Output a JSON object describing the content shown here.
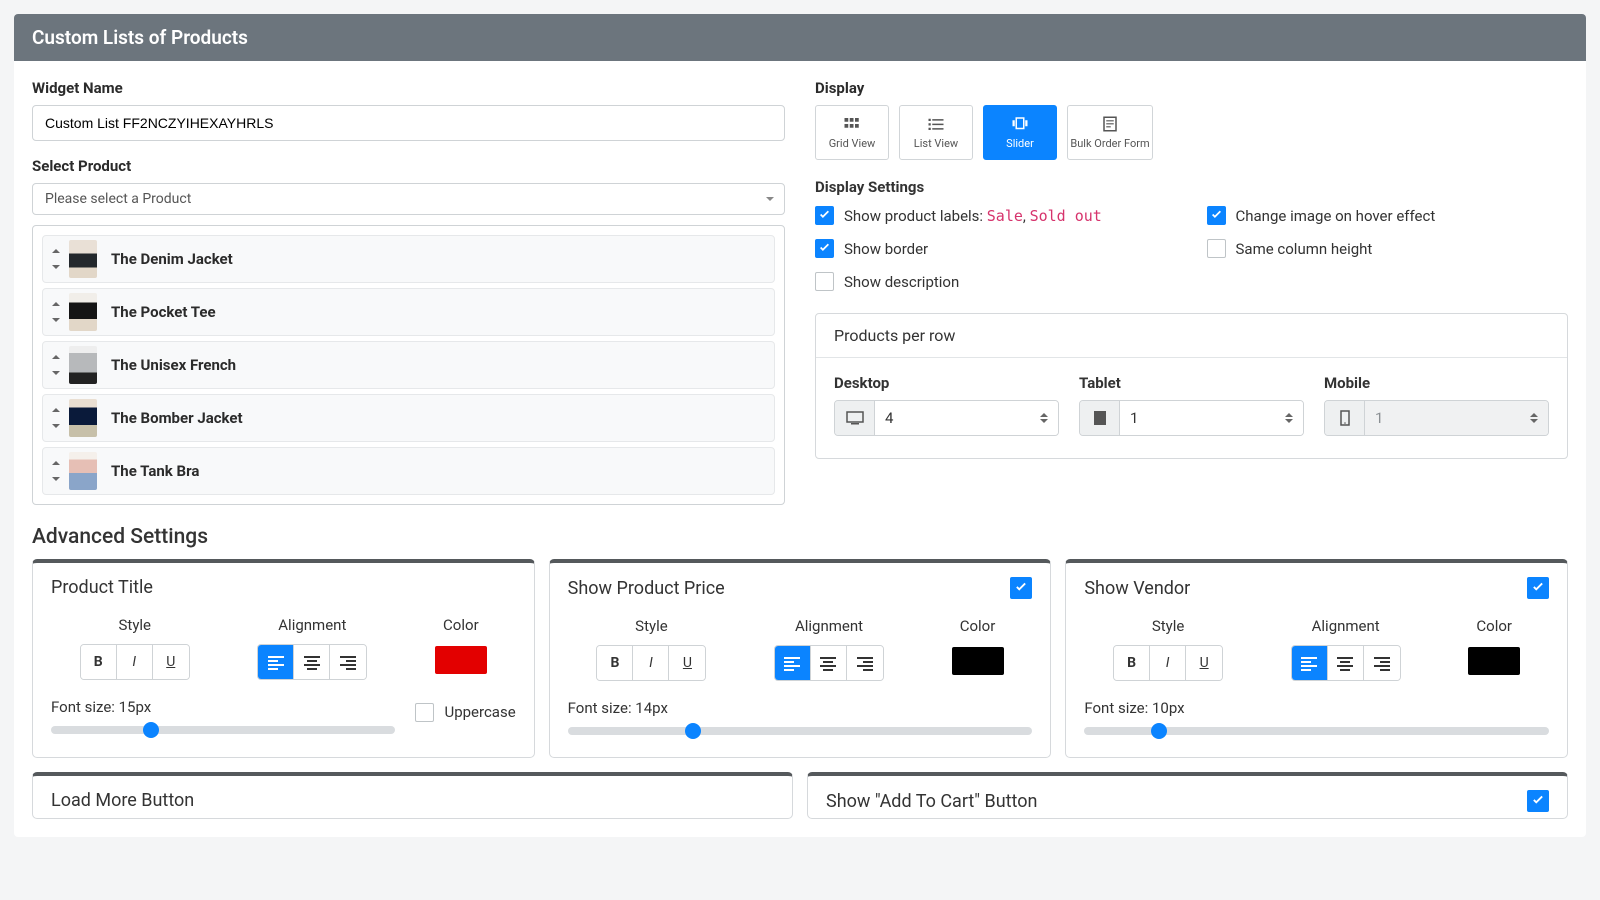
{
  "header": {
    "title": "Custom Lists of Products"
  },
  "widgetName": {
    "label": "Widget Name",
    "value": "Custom List FF2NCZYIHEXAYHRLS"
  },
  "selectProduct": {
    "label": "Select Product",
    "placeholder": "Please select a Product"
  },
  "products": [
    {
      "name": "The Denim Jacket"
    },
    {
      "name": "The Pocket Tee"
    },
    {
      "name": "The Unisex French"
    },
    {
      "name": "The Bomber Jacket"
    },
    {
      "name": "The Tank Bra"
    }
  ],
  "display": {
    "label": "Display",
    "options": {
      "grid": "Grid View",
      "list": "List View",
      "slider": "Slider",
      "bulk": "Bulk Order Form"
    },
    "selected": "slider"
  },
  "displaySettings": {
    "label": "Display Settings",
    "showLabelsPrefix": "Show product labels: ",
    "sale": "Sale",
    "sep": ", ",
    "soldOut": "Sold out",
    "showBorder": "Show border",
    "showDescription": "Show description",
    "hoverEffect": "Change image on hover effect",
    "sameColumnHeight": "Same column height"
  },
  "productsPerRow": {
    "title": "Products per row",
    "desktop": {
      "label": "Desktop",
      "value": "4"
    },
    "tablet": {
      "label": "Tablet",
      "value": "1"
    },
    "mobile": {
      "label": "Mobile",
      "value": "1"
    }
  },
  "advanced": {
    "title": "Advanced Settings",
    "style": "Style",
    "alignment": "Alignment",
    "color": "Color",
    "uppercase": "Uppercase",
    "productTitle": {
      "title": "Product Title",
      "fontSize": "Font size: 15px",
      "color": "#e30000",
      "sliderPct": 29
    },
    "price": {
      "title": "Show Product Price",
      "fontSize": "Font size: 14px",
      "color": "#000000",
      "sliderPct": 27
    },
    "vendor": {
      "title": "Show Vendor",
      "fontSize": "Font size: 10px",
      "color": "#000000",
      "sliderPct": 16
    },
    "loadMore": {
      "title": "Load More Button"
    },
    "addToCart": {
      "title": "Show \"Add To Cart\" Button"
    }
  }
}
